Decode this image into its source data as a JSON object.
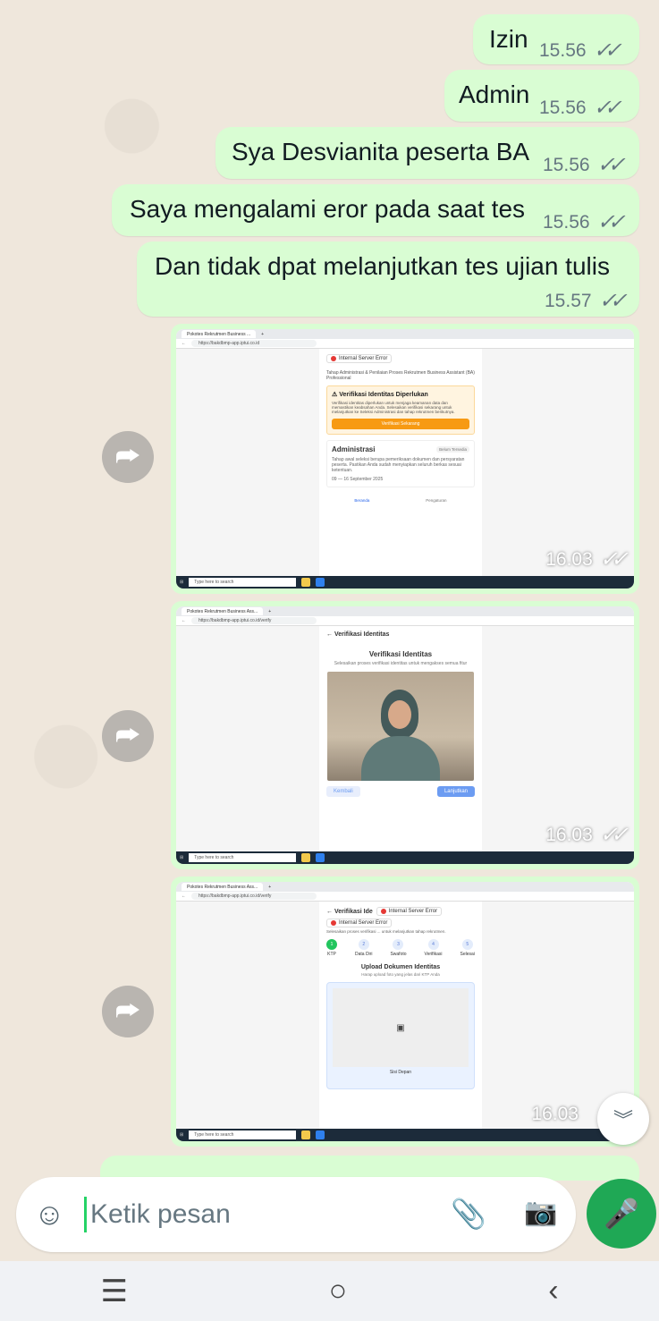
{
  "messages": [
    {
      "text": "Izin",
      "time": "15.56"
    },
    {
      "text": "Admin",
      "time": "15.56"
    },
    {
      "text": "Sya Desvianita peserta BA",
      "time": "15.56"
    },
    {
      "text": "Saya mengalami eror pada saat tes",
      "time": "15.56"
    },
    {
      "text": "Dan tidak dpat melanjutkan tes ujian tulis",
      "time": "15.57"
    }
  ],
  "images": [
    {
      "time": "16.03",
      "tab_title": "Pokotes Rekrutmen Business ...",
      "url": "https://bakdbmp-app.iptui.co.id",
      "error_toast": "Internal Server Error",
      "subtitle": "Tahap Administrasi & Penilaian Proses Rekrutmen Business Assistant (BA) Professional",
      "warn_title": "Verifikasi Identitas Diperlukan",
      "warn_body": "Verifikasi identitas diperlukan untuk menjaga keamanan data dan memastikan keabsahan Anda. Selesaikan verifikasi sekarang untuk melanjutkan ke Seleksi Administrasi dan tahap rekrutmen berikutnya.",
      "warn_button": "Verifikasi Sekarang",
      "admin_title": "Administrasi",
      "admin_badge": "Belum Tersedia",
      "admin_body": "Tahap awal seleksi berupa pemeriksaan dokumen dan persyaratan peserta. Pastikan Anda sudah menyiapkan seluruh berkas sesuai ketentuan.",
      "admin_date": "09 — 16 September 2025",
      "nav_home": "Beranda",
      "nav_settings": "Pengaturan",
      "taskbar_search": "Type here to search"
    },
    {
      "time": "16.03",
      "tab_title": "Pokotes Rekrutmen Business Ass...",
      "url": "https://bakdbmp-app.iptui.co.id/verify",
      "back_title": "Verifikasi Identitas",
      "heading": "Verifikasi Identitas",
      "desc": "Selesaikan proses verifikasi identitas untuk mengakses semua fitur",
      "back_button": "Kembali",
      "next_button": "Lanjutkan",
      "taskbar_search": "Type here to search"
    },
    {
      "time": "16.03",
      "tab_title": "Pokotes Rekrutmen Business Ass...",
      "url": "https://bakdbmp-app.iptui.co.id/verify",
      "back_title": "Verifikasi Ide",
      "error_toast_1": "Internal Server Error",
      "error_toast_2": "Internal Server Error",
      "intro": "Selesaikan proses verifikasi ... untuk melanjutkan tahap rekrutmen.",
      "steps": [
        {
          "num": "1",
          "label": "KTP"
        },
        {
          "num": "2",
          "label": "Data Diri"
        },
        {
          "num": "3",
          "label": "Swafoto"
        },
        {
          "num": "4",
          "label": "Verifikasi"
        },
        {
          "num": "5",
          "label": "Selesai"
        }
      ],
      "upload_title": "Upload Dokumen Identitas",
      "upload_desc": "Harap upload foto yang jelas dari KTP Anda",
      "side_label": "Sisi Depan",
      "taskbar_search": "Type here to search"
    }
  ],
  "input": {
    "placeholder": "Ketik pesan"
  },
  "icons": {
    "sticker": "sticker-icon",
    "attach": "paperclip-icon",
    "camera": "camera-icon",
    "mic": "mic-icon",
    "forward": "forward-icon",
    "scroll_down": "double-chevron-down-icon"
  },
  "colors": {
    "bubble": "#d9fdd3",
    "read_ticks": "#53bdeb",
    "accent": "#1fa855",
    "background": "#efe7dc"
  }
}
